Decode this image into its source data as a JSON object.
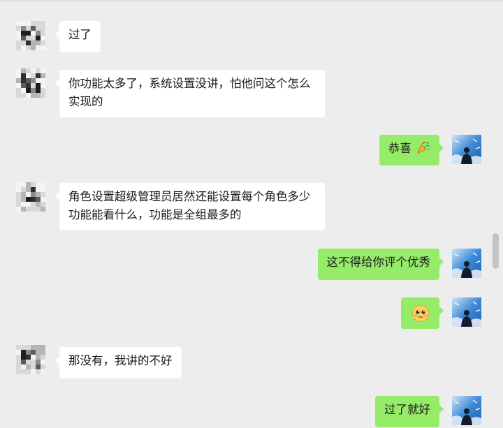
{
  "messages": [
    {
      "side": "left",
      "text": "过了"
    },
    {
      "side": "left",
      "text": "你功能太多了，系统设置没讲，怕他问这个怎么实现的"
    },
    {
      "side": "right",
      "text": "恭喜",
      "emoji": "party-popper-icon"
    },
    {
      "side": "left",
      "text": "角色设置超级管理员居然还能设置每个角色多少功能能看什么，功能是全组最多的"
    },
    {
      "side": "right",
      "text": "这不得给你评个优秀"
    },
    {
      "side": "right",
      "text": "",
      "emoji": "pleading-smiley-icon"
    },
    {
      "side": "left",
      "text": "那没有，我讲的不好"
    },
    {
      "side": "right",
      "text": "过了就好"
    }
  ],
  "colors": {
    "background": "#ededed",
    "left_bubble": "#ffffff",
    "right_bubble": "#95ec69",
    "text": "#1a1a1a"
  },
  "avatars": {
    "left": "pixelated-avatar",
    "right": "sky-silhouette-avatar"
  }
}
